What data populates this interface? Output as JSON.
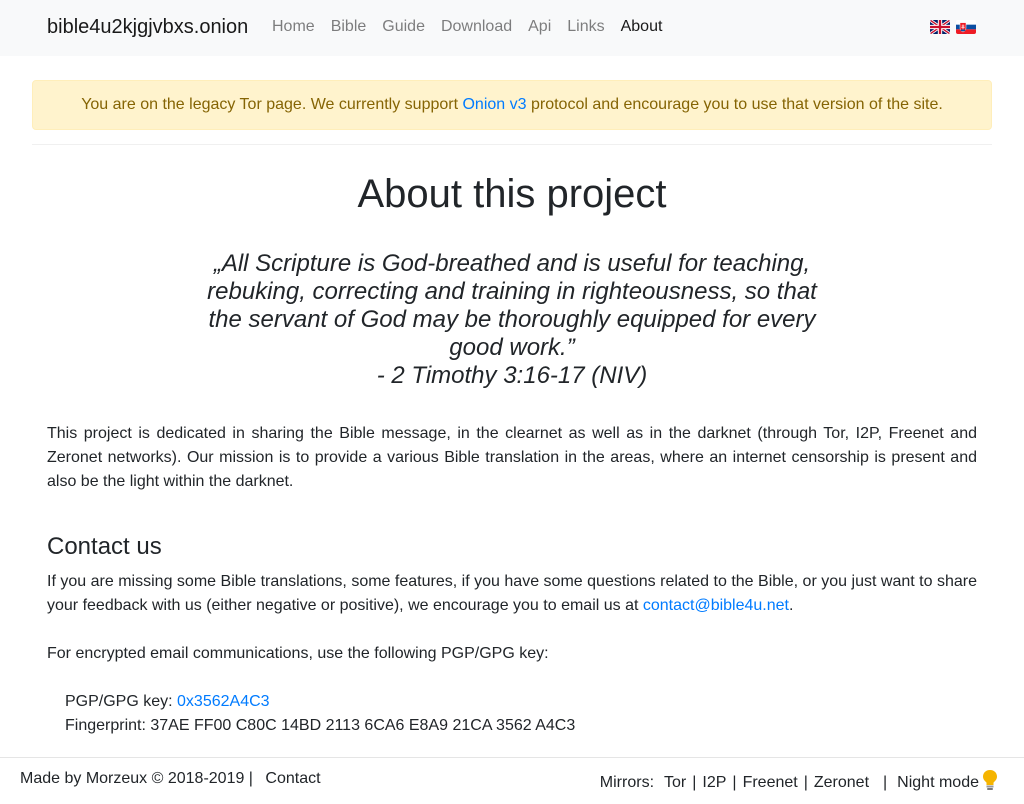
{
  "navbar": {
    "brand": "bible4u2kjgjvbxs.onion",
    "links": [
      {
        "label": "Home"
      },
      {
        "label": "Bible"
      },
      {
        "label": "Guide"
      },
      {
        "label": "Download"
      },
      {
        "label": "Api"
      },
      {
        "label": "Links"
      },
      {
        "label": "About",
        "active": true
      }
    ],
    "flags": [
      "uk-flag-icon",
      "slovak-flag-icon"
    ]
  },
  "alert": {
    "text_before": "You are on the legacy Tor page. We currently support ",
    "link": "Onion v3",
    "text_after": " protocol and encourage you to use that version of the site."
  },
  "main": {
    "title": "About this project",
    "quote": "„All Scripture is God-breathed and is useful for teaching, rebuking, correcting and training in righteousness, so that the servant of God may be thoroughly equipped for every good work.”",
    "quote_ref": "- 2 Timothy 3:16-17 (NIV)",
    "paragraph": "This project is dedicated in sharing the Bible message, in the clearnet as well as in the darknet (through Tor, I2P, Freenet and Zeronet networks). Our mission is to provide a various Bible translation in the areas, where an internet censorship is present and also be the light within the darknet."
  },
  "contact": {
    "heading": "Contact us",
    "text": "If you are missing some Bible translations, some features, if you have some questions related to the Bible, or you just want to share your feedback with us (either negative or positive), we encourage you to email us at ",
    "email": "contact@bible4u.net",
    "text_end": ".",
    "pgp_intro": "For encrypted email communications, use the following PGP/GPG key:",
    "pgp_label": "PGP/GPG key: ",
    "pgp_key": "0x3562A4C3",
    "fingerprint": "Fingerprint: 37AE FF00 C80C 14BD 2113 6CA6 E8A9 21CA 3562 A4C3"
  },
  "footer": {
    "made_by": "Made by Morzeux © 2018-2019 | ",
    "contact": "Contact",
    "mirrors_label": "Mirrors:",
    "mirrors": [
      "Tor",
      "I2P",
      "Freenet",
      "Zeronet"
    ],
    "night_mode": "Night mode",
    "bulb_icon": "lightbulb-icon",
    "bulb_color": "#f5b400"
  }
}
